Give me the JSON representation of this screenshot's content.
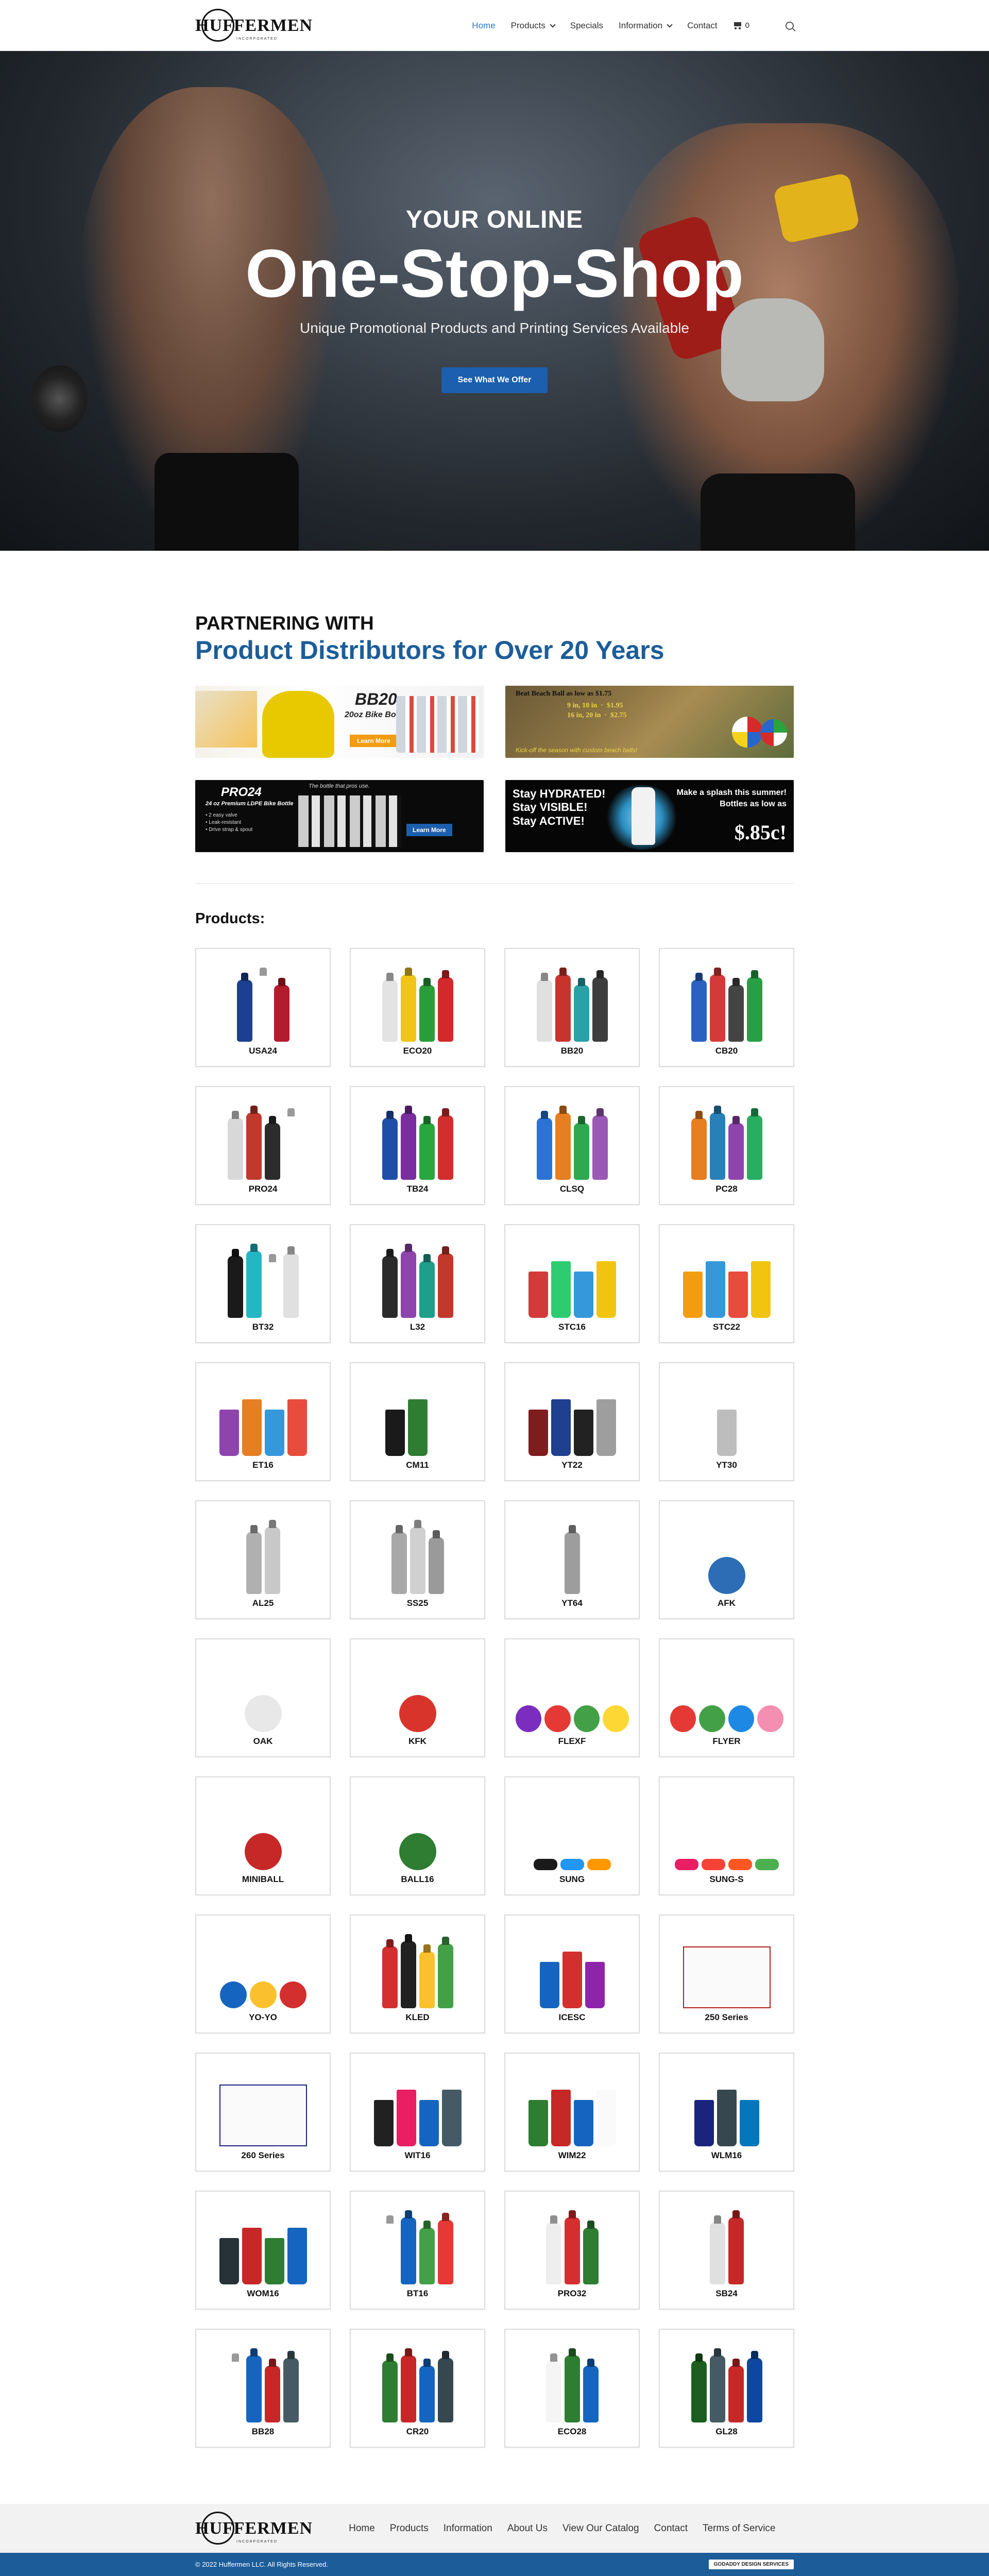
{
  "brand": {
    "name": "HUFFERMEN",
    "tagline": "INCORPORATED"
  },
  "nav": {
    "items": [
      {
        "label": "Home",
        "active": true,
        "dropdown": false
      },
      {
        "label": "Products",
        "active": false,
        "dropdown": true
      },
      {
        "label": "Specials",
        "active": false,
        "dropdown": false
      },
      {
        "label": "Information",
        "active": false,
        "dropdown": true
      },
      {
        "label": "Contact",
        "active": false,
        "dropdown": false
      }
    ],
    "cart_count": "0",
    "icons": {
      "cart": "cart-icon",
      "search": "search-icon"
    }
  },
  "hero": {
    "kicker": "YOUR ONLINE",
    "title": "One-Stop-Shop",
    "subtitle": "Unique Promotional Products and Printing Services Available",
    "cta": "See What We Offer"
  },
  "partner": {
    "kicker": "PARTNERING WITH",
    "title": "Product Distributors for Over 20 Years",
    "banners": {
      "b1": {
        "title": "BB20",
        "subtitle": "20oz Bike Bottle",
        "button": "Learn More"
      },
      "b2": {
        "line1": "Beat Beach Ball as low as $1.75",
        "line2": "9 in, 10 in  ·  $1.95\n16 in, 20 in  ·  $2.75",
        "footer": "Kick-off the season with custom beach balls!"
      },
      "b3": {
        "title": "PRO24",
        "subtitle": "24 oz Premium LDPE Bike Bottle",
        "features": "• 2 easy valve\n• Leak-resistant\n• Drive strap & spout",
        "quote": "The bottle that pros use.",
        "button": "Learn More"
      },
      "b4": {
        "left": "Stay HYDRATED!\nStay VISIBLE!\nStay ACTIVE!",
        "right": "Make a splash this summer!\nBottles as low as",
        "price": "$.85c!"
      }
    }
  },
  "products": {
    "title": "Products:",
    "items": [
      {
        "label": "USA24",
        "kind": "bottle",
        "colors": [
          "#1d3f8f",
          "#ffffff",
          "#b11d2c"
        ]
      },
      {
        "label": "ECO20",
        "kind": "bottle",
        "colors": [
          "#e3e3e3",
          "#f0c419",
          "#2a9d3a",
          "#d22a2a"
        ]
      },
      {
        "label": "BB20",
        "kind": "bottle",
        "colors": [
          "#e0e0e0",
          "#c7342d",
          "#2aa1a6",
          "#3e3e3e"
        ]
      },
      {
        "label": "CB20",
        "kind": "bottle",
        "colors": [
          "#2b62c0",
          "#d53a3a",
          "#444444",
          "#27a045"
        ]
      },
      {
        "label": "PRO24",
        "kind": "bottle",
        "colors": [
          "#d8d8d8",
          "#c0392b",
          "#2c2c2c",
          "#ffffff"
        ]
      },
      {
        "label": "TB24",
        "kind": "bottle",
        "colors": [
          "#1f4ea8",
          "#7a2d9e",
          "#29a63f",
          "#d12e2e"
        ]
      },
      {
        "label": "CLSQ",
        "kind": "bottle",
        "colors": [
          "#2b74d6",
          "#e67e22",
          "#2fa84f",
          "#9b59b6"
        ]
      },
      {
        "label": "PC28",
        "kind": "bottle",
        "colors": [
          "#e67e22",
          "#2980b9",
          "#8e44ad",
          "#27ae60"
        ]
      },
      {
        "label": "BT32",
        "kind": "bottle",
        "colors": [
          "#1a1a1a",
          "#25b6c4",
          "#ffffff",
          "#e0e0e0"
        ]
      },
      {
        "label": "L32",
        "kind": "bottle",
        "colors": [
          "#2b2b2b",
          "#8e44ad",
          "#1f9e89",
          "#c0392b"
        ]
      },
      {
        "label": "STC16",
        "kind": "cup",
        "colors": [
          "#d33a3a",
          "#2ecc71",
          "#3498db",
          "#f1c40f"
        ]
      },
      {
        "label": "STC22",
        "kind": "cup",
        "colors": [
          "#f39c12",
          "#3498db",
          "#e74c3c",
          "#f1c40f"
        ]
      },
      {
        "label": "ET16",
        "kind": "cup",
        "colors": [
          "#8e44ad",
          "#e67e22",
          "#3498db",
          "#e74c3c"
        ]
      },
      {
        "label": "CM11",
        "kind": "cup",
        "colors": [
          "#1a1a1a",
          "#2e7d32",
          "#ffffff"
        ]
      },
      {
        "label": "YT22",
        "kind": "cup",
        "colors": [
          "#7d1d1d",
          "#1f3f8f",
          "#222222",
          "#9e9e9e"
        ]
      },
      {
        "label": "YT30",
        "kind": "cup",
        "colors": [
          "#bdbdbd"
        ]
      },
      {
        "label": "AL25",
        "kind": "bottle",
        "colors": [
          "#b0b0b0",
          "#c8c8c8"
        ]
      },
      {
        "label": "SS25",
        "kind": "bottle",
        "colors": [
          "#a8a8a8",
          "#d0d0d0",
          "#9a9a9a"
        ]
      },
      {
        "label": "YT64",
        "kind": "bottle",
        "colors": [
          "#9d9d9d"
        ]
      },
      {
        "label": "AFK",
        "kind": "round",
        "colors": [
          "#2c6db5"
        ]
      },
      {
        "label": "OAK",
        "kind": "round",
        "colors": [
          "#e8e8e8"
        ]
      },
      {
        "label": "KFK",
        "kind": "round",
        "colors": [
          "#d9342b"
        ]
      },
      {
        "label": "FLEXF",
        "kind": "round",
        "colors": [
          "#7b2dbf",
          "#e53935",
          "#43a047",
          "#fdd835"
        ]
      },
      {
        "label": "FLYER",
        "kind": "round",
        "colors": [
          "#e53935",
          "#43a047",
          "#1e88e5",
          "#f48fb1"
        ]
      },
      {
        "label": "MINIBALL",
        "kind": "round",
        "colors": [
          "#c62828"
        ]
      },
      {
        "label": "BALL16",
        "kind": "round",
        "colors": [
          "#2e7d32"
        ]
      },
      {
        "label": "SUNG",
        "kind": "glasses",
        "colors": [
          "#1a1a1a",
          "#2196f3",
          "#ff9800"
        ]
      },
      {
        "label": "SUNG-S",
        "kind": "glasses",
        "colors": [
          "#e91e63",
          "#f44336",
          "#ff5722",
          "#4caf50"
        ]
      },
      {
        "label": "YO-YO",
        "kind": "round",
        "colors": [
          "#1565c0",
          "#fbc02d",
          "#d32f2f"
        ]
      },
      {
        "label": "KLED",
        "kind": "bottle",
        "colors": [
          "#d32f2f",
          "#212121",
          "#fbc02d",
          "#43a047"
        ]
      },
      {
        "label": "ICESC",
        "kind": "cup",
        "colors": [
          "#1565c0",
          "#d32f2f",
          "#8e24aa"
        ]
      },
      {
        "label": "250 Series",
        "kind": "paper",
        "colors": [
          "#b71c1c"
        ]
      },
      {
        "label": "260 Series",
        "kind": "paper",
        "colors": [
          "#1a237e"
        ]
      },
      {
        "label": "WIT16",
        "kind": "cup",
        "colors": [
          "#212121",
          "#e91e63",
          "#1565c0",
          "#455a64"
        ]
      },
      {
        "label": "WIM22",
        "kind": "cup",
        "colors": [
          "#2e7d32",
          "#c62828",
          "#1565c0",
          "#fafafa"
        ]
      },
      {
        "label": "WLM16",
        "kind": "cup",
        "colors": [
          "#1a237e",
          "#37474f",
          "#0277bd"
        ]
      },
      {
        "label": "WOM16",
        "kind": "cup",
        "colors": [
          "#263238",
          "#c62828",
          "#2e7d32",
          "#1565c0"
        ]
      },
      {
        "label": "BT16",
        "kind": "bottle",
        "colors": [
          "#ffffff",
          "#1565c0",
          "#43a047",
          "#e53935"
        ]
      },
      {
        "label": "PRO32",
        "kind": "bottle",
        "colors": [
          "#eeeeee",
          "#d32f2f",
          "#2e7d32"
        ]
      },
      {
        "label": "SB24",
        "kind": "bottle",
        "colors": [
          "#e0e0e0",
          "#c62828"
        ]
      },
      {
        "label": "BB28",
        "kind": "bottle",
        "colors": [
          "#ffffff",
          "#1565c0",
          "#c62828",
          "#455a64"
        ]
      },
      {
        "label": "CR20",
        "kind": "bottle",
        "colors": [
          "#2e7d32",
          "#c62828",
          "#1565c0",
          "#37474f"
        ]
      },
      {
        "label": "ECO28",
        "kind": "bottle",
        "colors": [
          "#f5f5f5",
          "#2e7d32",
          "#1565c0"
        ]
      },
      {
        "label": "GL28",
        "kind": "bottle",
        "colors": [
          "#1b5e20",
          "#455a64",
          "#c62828",
          "#0d47a1"
        ]
      }
    ]
  },
  "footer": {
    "links": [
      "Home",
      "Products",
      "Information",
      "About Us",
      "View Our Catalog",
      "Contact",
      "Terms of Service"
    ],
    "copyright": "© 2022 Huffermen LLC. All Rights Reserved.",
    "badge": "GODADDY DESIGN SERVICES"
  },
  "colors": {
    "accent": "#1c5d99",
    "nav_active": "#2e75c5",
    "cta": "#1b5fae"
  }
}
